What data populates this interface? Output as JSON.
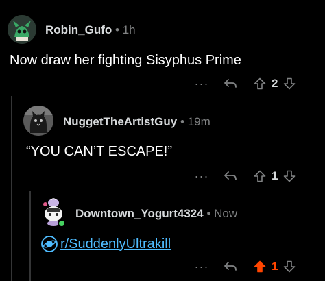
{
  "colors": {
    "background": "#000000",
    "thread_line": "#343536",
    "meta_gray": "#818384",
    "link_blue": "#4fbcff",
    "upvote_orange": "#ff4500"
  },
  "comments": [
    {
      "author": "Robin_Gufo",
      "separator": "•",
      "time": "1h",
      "text": "Now draw her fighting Sisyphus Prime",
      "more": "···",
      "vote_count": "2",
      "upvoted": false,
      "avatar_icon": "green-creature-avatar-icon"
    },
    {
      "author": "NuggetTheArtistGuy",
      "separator": "•",
      "time": "19m",
      "text": "“YOU CAN’T ESCAPE!”",
      "more": "···",
      "vote_count": "1",
      "upvoted": false,
      "avatar_icon": "cat-avatar-icon"
    },
    {
      "author": "Downtown_Yogurt4324",
      "separator": "•",
      "time": "Now",
      "subreddit_link": "r/SuddenlyUltrakill",
      "more": "···",
      "vote_count": "1",
      "upvoted": true,
      "avatar_icon": "snoo-avatar-icon"
    }
  ]
}
